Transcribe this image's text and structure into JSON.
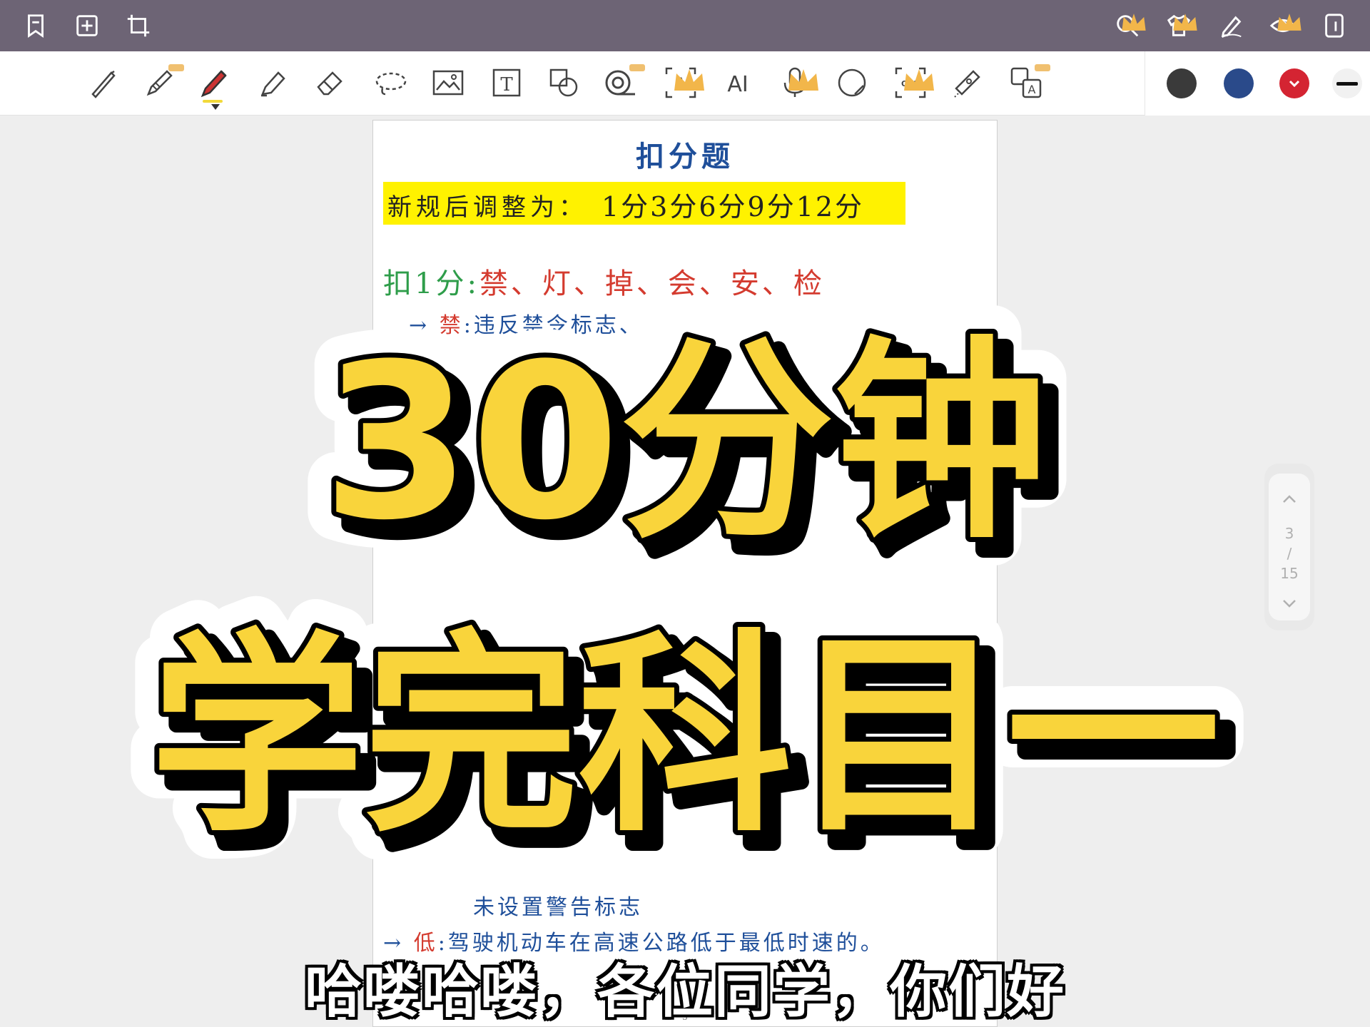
{
  "toolbar": {
    "tools": [
      "pen",
      "pencil",
      "marker",
      "highlighter",
      "eraser",
      "lasso",
      "image",
      "text",
      "shape",
      "tape",
      "text-recognition",
      "ai",
      "voice",
      "laser",
      "ocr",
      "ruler",
      "translate"
    ],
    "ai_label": "AI",
    "ocr_label": "OCR",
    "text_label": "T",
    "colors": [
      "#3a3a3a",
      "#2a4a8a",
      "#d42432",
      "#111111"
    ]
  },
  "document": {
    "title": "扣分题",
    "highlight_prefix": "新规后调整为：",
    "highlight_values": "1分3分6分9分12分",
    "row1_prefix": "扣1分:",
    "row1_items": "禁、灯、掉、会、安、检",
    "row2_arrow": "→",
    "row2_key": "禁",
    "row2_text": ":违反禁令标志、",
    "row3_text": "未设置警告标志",
    "row4_arrow": "→",
    "row4_key": "低",
    "row4_text": ":驾驶机动车在高速公路低于最低时速的。",
    "page_number": "3"
  },
  "pager": {
    "current": "3",
    "separator": "/",
    "total": "15"
  },
  "overlay": {
    "line1": "30分钟",
    "line2": "学完科目一"
  },
  "subtitle": "哈喽哈喽，各位同学，你们好"
}
